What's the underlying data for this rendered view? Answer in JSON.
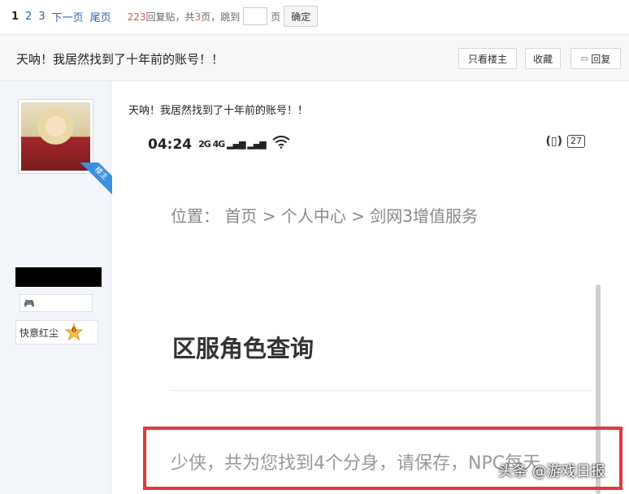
{
  "pager": {
    "current": "1",
    "pages": [
      "2",
      "3"
    ],
    "next_label": "下一页",
    "last_label": "尾页",
    "reply_count": "223",
    "reply_suffix": "回复贴，共",
    "page_total": "3",
    "page_suffix": "页，跳到",
    "jump_unit": "页",
    "confirm_label": "确定"
  },
  "thread": {
    "title": "天呐！我居然找到了十年前的账号！！",
    "only_host_label": "只看楼主",
    "favorite_label": "收藏",
    "reply_label": "回复",
    "reply_icon": "comment-icon"
  },
  "user": {
    "host_badge": "楼主",
    "medal_icon": "gamepad-icon",
    "level_name": "快意红尘",
    "level_number": "6"
  },
  "post": {
    "title": "天呐！我居然找到了十年前的账号！！",
    "phone": {
      "time": "04:24",
      "signal_text": "2G 4G",
      "battery": "27",
      "breadcrumb": "位置：  首页 > 个人中心 > 剑网3增值服务",
      "section_title": "区服角色查询",
      "result_text": "少侠，共为您找到4个分身，请保存，NPC每天"
    }
  },
  "watermark": "头条 @游戏日报",
  "colors": {
    "link": "#2d64b3",
    "highlight": "#e4383b",
    "host_badge": "#3b8fe0"
  }
}
